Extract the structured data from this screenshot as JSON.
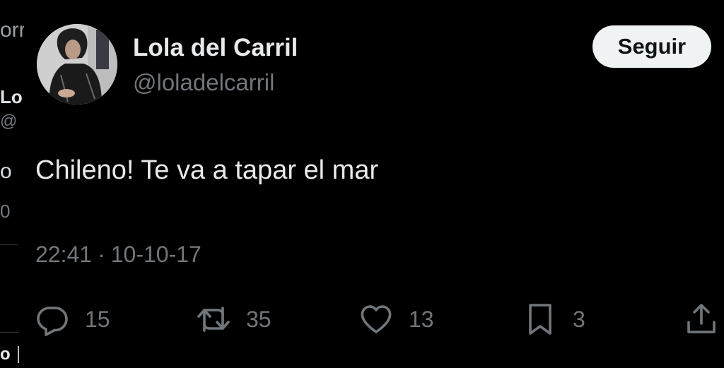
{
  "left_column": {
    "fragments": [
      "orr",
      "Lo",
      "@",
      "o",
      "0",
      "o"
    ]
  },
  "tweet": {
    "author": {
      "display_name": "Lola del Carril",
      "handle": "@loladelcarril"
    },
    "follow_label": "Seguir",
    "text": "Chileno! Te va a tapar el mar",
    "time": "22:41",
    "separator": "·",
    "date": "10-10-17",
    "stats": {
      "replies": "15",
      "retweets": "35",
      "likes": "13",
      "bookmarks": "3"
    }
  },
  "colors": {
    "background": "#000000",
    "text_primary": "#e7e9ea",
    "text_secondary": "#71767b",
    "button_bg": "#eff3f4",
    "button_text": "#0f1419"
  },
  "icons": {
    "reply": "reply-icon",
    "retweet": "retweet-icon",
    "like": "heart-icon",
    "bookmark": "bookmark-icon",
    "share": "share-icon"
  }
}
